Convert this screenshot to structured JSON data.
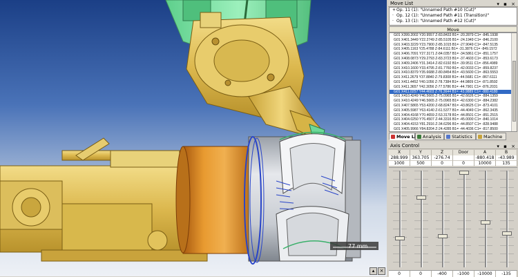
{
  "viewport": {
    "scale_label": "77 mm"
  },
  "move_list_panel": {
    "title": "Move List",
    "operations": [
      {
        "label": "Op. 11 (1): \"Unnamed Path #10 (Cut)\""
      },
      {
        "label": "Op. 12 (1): \"Unnamed Path #11 (Transition)\""
      },
      {
        "label": "Op. 13 (1): \"Unnamed Path #12 (Cut)\""
      }
    ],
    "move_header": "Move",
    "lines": [
      "G01 X399.2002 Y20.9557 Z-83.8433 B1= -20.2879 C1= -845.1938",
      "G01 X401.3449 Y22.2749 Z-85.5105 B1= -24.1949 C1= -846.2100",
      "G01 X403.3229 Y23.7900 Z-85.1015 B1= -27.9049 C1= -847.5135",
      "G01 X405.1163 Y25.4788 Z-84.6111 B1= -31.3876 C1= -849.1572",
      "G01 X406.7091 Y27.3171 Z-84.0357 B1= -34.5861 C1= -851.1757",
      "G01 X408.0873 Y29.2793 Z-83.3723 B1= -37.4603 C1= -853.6173",
      "G01 X409.2406 Y31.3414 Z-82.6192 B1= -39.9511 C1= -856.4989",
      "G01 X410.1600 Y33.4795 Z-81.7760 B1= -42.0033 C1= -859.8237",
      "G01 X410.8379 Y35.6688 Z-80.8454 B1= -43.5600 C1= -863.5553",
      "G01 X411.2679 Y37.8840 Z-79.8308 B1= -44.5681 C1= -867.6111",
      "G01 X411.4452 Y40.1056 Z-78.7384 B1= -44.9809 C1= -871.8592",
      "G01 X411.3657 Y42.3056 Z-77.5786 B1= -44.7901 C1= -876.2031",
      "G01 X411.0257 Y44.4603 Z-76.3644 B1= -43.9889 C1= -880.4180",
      "G01 X410.4249 Y46.5665 Z-75.0965 B1= -42.6626 C1= -884.1359",
      "G01 X410.4249 Y46.5665 Z-75.0965 B1= -42.6300 C1= -884.2382",
      "G01 X407.5865 Y53.4200 Z-68.8247 B1= -43.8625 C1= -873.4101",
      "G01 X405.5987 Y63.4140 Z-61.5377 B1= -44.4049 C1= -862.3435",
      "G01 X404.4168 Y70.4659 Z-53.3178 B1= -44.8501 C1= -851.2515",
      "G01 X404.0250 Y76.4507 Z-44.3316 B1= -45.0000 C1= -840.1014",
      "G01 X404.4153 Y81.2916 Z-34.6296 B1= -44.8507 C1= -828.9488",
      "G01 X405.9966 Y84.8204 Z-24.4285 B1= -44.4036 C1= -817.8500",
      "G01 X407.5851 Y87.2701 Z-13.0619 B1= -43.6499 C1= -806.7758",
      "G01 X410.4249 Y88.3113 Z-3.0544 B1= -42.6307 C1= -795.9405"
    ],
    "selected_index": 12
  },
  "tabs": [
    {
      "label": "Move List",
      "active": true,
      "color": "#cc3333"
    },
    {
      "label": "Analysis",
      "active": false,
      "color": "#3a7a3a"
    },
    {
      "label": "Statistics",
      "active": false,
      "color": "#5577cc"
    },
    {
      "label": "Machine",
      "active": false,
      "color": "#c6a23a"
    }
  ],
  "axis_control": {
    "title": "Axis Control",
    "axes": [
      {
        "name": "X",
        "value": "288.999",
        "upper": "1000",
        "lower": "0",
        "level": 0.29
      },
      {
        "name": "Y",
        "value": "363.705",
        "upper": "500",
        "lower": "0",
        "level": 0.73
      },
      {
        "name": "Z",
        "value": "-276.74",
        "upper": "0",
        "lower": "-400",
        "level": 0.31
      },
      {
        "name": "Door",
        "value": "",
        "upper": "0",
        "lower": "-1000",
        "level": 1.0
      },
      {
        "name": "A",
        "value": "-880.418",
        "upper": "10000",
        "lower": "-10000",
        "level": 0.46
      },
      {
        "name": "B",
        "value": "-43.989",
        "upper": "135",
        "lower": "-135",
        "level": 0.34
      }
    ]
  },
  "colors": {
    "selection": "#316ac5",
    "part_gold": "#e2c35c",
    "fixture_green": "#7fe0a6",
    "stock_orange": "#d9861e",
    "toolpath_blue": "#2844c8"
  }
}
